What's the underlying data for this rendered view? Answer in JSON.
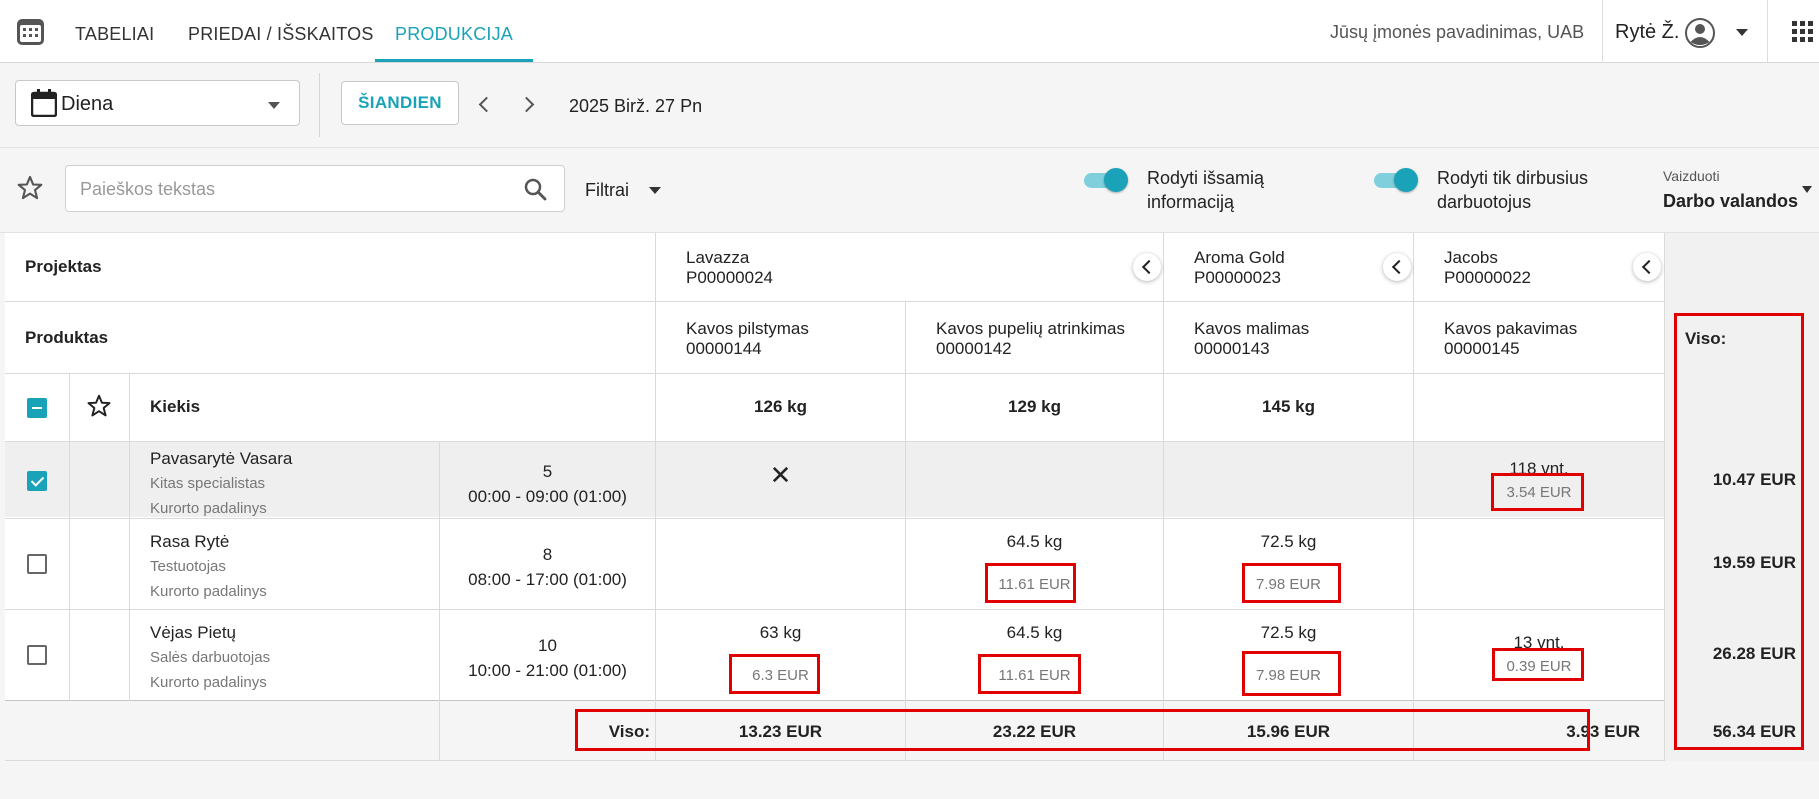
{
  "nav": {
    "tabs": [
      "TABELIAI",
      "PRIEDAI / IŠSKAITOS",
      "PRODUKCIJA"
    ],
    "active_tab": "PRODUKCIJA",
    "company": "Jūsų įmonės pavadinimas, UAB",
    "user": "Rytė Ž."
  },
  "toolbar": {
    "period": "Diena",
    "today_label": "ŠIANDIEN",
    "date": "2025 Birž. 27 Pn"
  },
  "filters": {
    "search_placeholder": "Paieškos tekstas",
    "filters_label": "Filtrai",
    "toggle_detail_line1": "Rodyti išsamią",
    "toggle_detail_line2": "informaciją",
    "toggle_detail_on": true,
    "toggle_worked_line1": "Rodyti tik dirbusius",
    "toggle_worked_line2": "darbuotojus",
    "toggle_worked_on": true,
    "view_label": "Vaizduoti",
    "view_value": "Darbo valandos"
  },
  "table": {
    "project_header": "Projektas",
    "product_header": "Produktas",
    "quantity_header": "Kiekis",
    "total_header": "Viso:",
    "projects": [
      {
        "name": "Lavazza",
        "code": "P00000024"
      },
      {
        "name": "Aroma Gold",
        "code": "P00000023"
      },
      {
        "name": "Jacobs",
        "code": "P00000022"
      }
    ],
    "products": [
      {
        "name": "Kavos pilstymas",
        "code": "00000144",
        "quantity": "126 kg"
      },
      {
        "name": "Kavos pupelių atrinkimas",
        "code": "00000142",
        "quantity": "129 kg"
      },
      {
        "name": "Kavos malimas",
        "code": "00000143",
        "quantity": "145 kg"
      },
      {
        "name": "Kavos pakavimas",
        "code": "00000145",
        "quantity": ""
      }
    ],
    "rows": [
      {
        "name": "Pavasarytė Vasara",
        "role": "Kitas specialistas",
        "unit": "Kurorto padalinys",
        "num": "5",
        "time": "00:00 - 09:00 (01:00)",
        "checked": true,
        "cells": [
          {
            "qty": "",
            "eur": "",
            "mark": "✕"
          },
          {
            "qty": "",
            "eur": ""
          },
          {
            "qty": "",
            "eur": ""
          },
          {
            "qty": "118 vnt.",
            "eur": "3.54 EUR"
          }
        ],
        "total": "10.47 EUR"
      },
      {
        "name": "Rasa Rytė",
        "role": "Testuotojas",
        "unit": "Kurorto padalinys",
        "num": "8",
        "time": "08:00 - 17:00 (01:00)",
        "checked": false,
        "cells": [
          {
            "qty": "",
            "eur": ""
          },
          {
            "qty": "64.5 kg",
            "eur": "11.61 EUR"
          },
          {
            "qty": "72.5 kg",
            "eur": "7.98 EUR"
          },
          {
            "qty": "",
            "eur": ""
          }
        ],
        "total": "19.59 EUR"
      },
      {
        "name": "Vėjas Pietų",
        "role": "Salės darbuotojas",
        "unit": "Kurorto padalinys",
        "num": "10",
        "time": "10:00 - 21:00 (01:00)",
        "checked": false,
        "cells": [
          {
            "qty": "63 kg",
            "eur": "6.3 EUR"
          },
          {
            "qty": "64.5 kg",
            "eur": "11.61 EUR"
          },
          {
            "qty": "72.5 kg",
            "eur": "7.98 EUR"
          },
          {
            "qty": "13 vnt.",
            "eur": "0.39 EUR"
          }
        ],
        "total": "26.28 EUR"
      }
    ],
    "footer": {
      "label": "Viso:",
      "totals": [
        "13.23 EUR",
        "23.22 EUR",
        "15.96 EUR",
        "3.93 EUR"
      ],
      "grand_total": "56.34 EUR"
    }
  },
  "colors": {
    "accent": "#1aa2b8",
    "highlight": "#e00000"
  }
}
